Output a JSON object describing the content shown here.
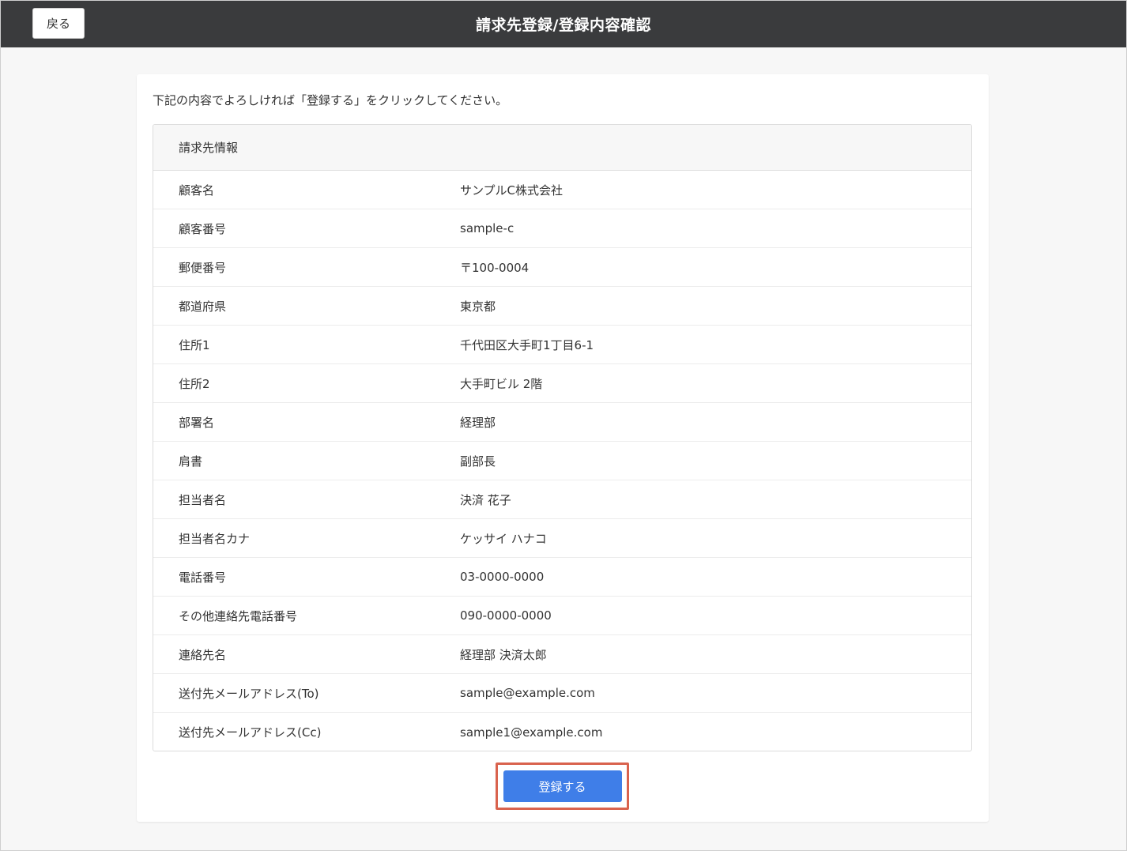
{
  "header": {
    "back_label": "戻る",
    "title": "請求先登録/登録内容確認"
  },
  "main": {
    "instruction": "下記の内容でよろしければ「登録する」をクリックしてください。",
    "section_title": "請求先情報",
    "rows": [
      {
        "label": "顧客名",
        "value": "サンプルC株式会社"
      },
      {
        "label": "顧客番号",
        "value": "sample-c"
      },
      {
        "label": "郵便番号",
        "value": "〒100-0004"
      },
      {
        "label": "都道府県",
        "value": "東京都"
      },
      {
        "label": "住所1",
        "value": "千代田区大手町1丁目6-1"
      },
      {
        "label": "住所2",
        "value": "大手町ビル 2階"
      },
      {
        "label": "部署名",
        "value": "経理部"
      },
      {
        "label": "肩書",
        "value": "副部長"
      },
      {
        "label": "担当者名",
        "value": "決済 花子"
      },
      {
        "label": "担当者名カナ",
        "value": "ケッサイ ハナコ"
      },
      {
        "label": "電話番号",
        "value": "03-0000-0000"
      },
      {
        "label": "その他連絡先電話番号",
        "value": "090-0000-0000"
      },
      {
        "label": "連絡先名",
        "value": "経理部 決済太郎"
      },
      {
        "label": "送付先メールアドレス(To)",
        "value": "sample@example.com"
      },
      {
        "label": "送付先メールアドレス(Cc)",
        "value": "sample1@example.com"
      }
    ],
    "submit_label": "登録する"
  },
  "colors": {
    "header_bg": "#3a3b3d",
    "primary_button": "#3f7ee8",
    "highlight": "#d9634e"
  }
}
